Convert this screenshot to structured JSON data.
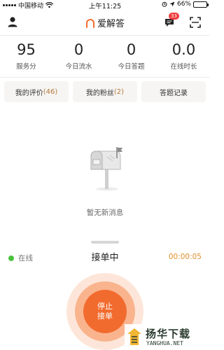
{
  "status_bar": {
    "carrier": "中国移动",
    "time": "上午11:25",
    "battery_text": "66%",
    "battery_level": 0.66
  },
  "header": {
    "app_name": "爱解答",
    "message_badge": "33"
  },
  "stats": [
    {
      "value": "95",
      "label": "服务分"
    },
    {
      "value": "0",
      "label": "今日流水"
    },
    {
      "value": "0",
      "label": "今日答题"
    },
    {
      "value": "0.0",
      "label": "在线时长"
    }
  ],
  "actions": [
    {
      "label": "我的评价",
      "count": "(46)"
    },
    {
      "label": "我的粉丝",
      "count": "(2)"
    },
    {
      "label": "答题记录",
      "count": ""
    }
  ],
  "empty_state": {
    "message": "暂无新消息"
  },
  "panel": {
    "status": "在线",
    "state": "接单中",
    "timer": "00:00:05",
    "stop_label": "停止\n接单"
  },
  "watermark": {
    "title": "扬华下载",
    "url": "YANGHUA.NET"
  },
  "colors": {
    "accent": "#f26b2e",
    "online": "#4cc23c",
    "timer": "#e0902f",
    "badge": "#ef3b3b"
  }
}
